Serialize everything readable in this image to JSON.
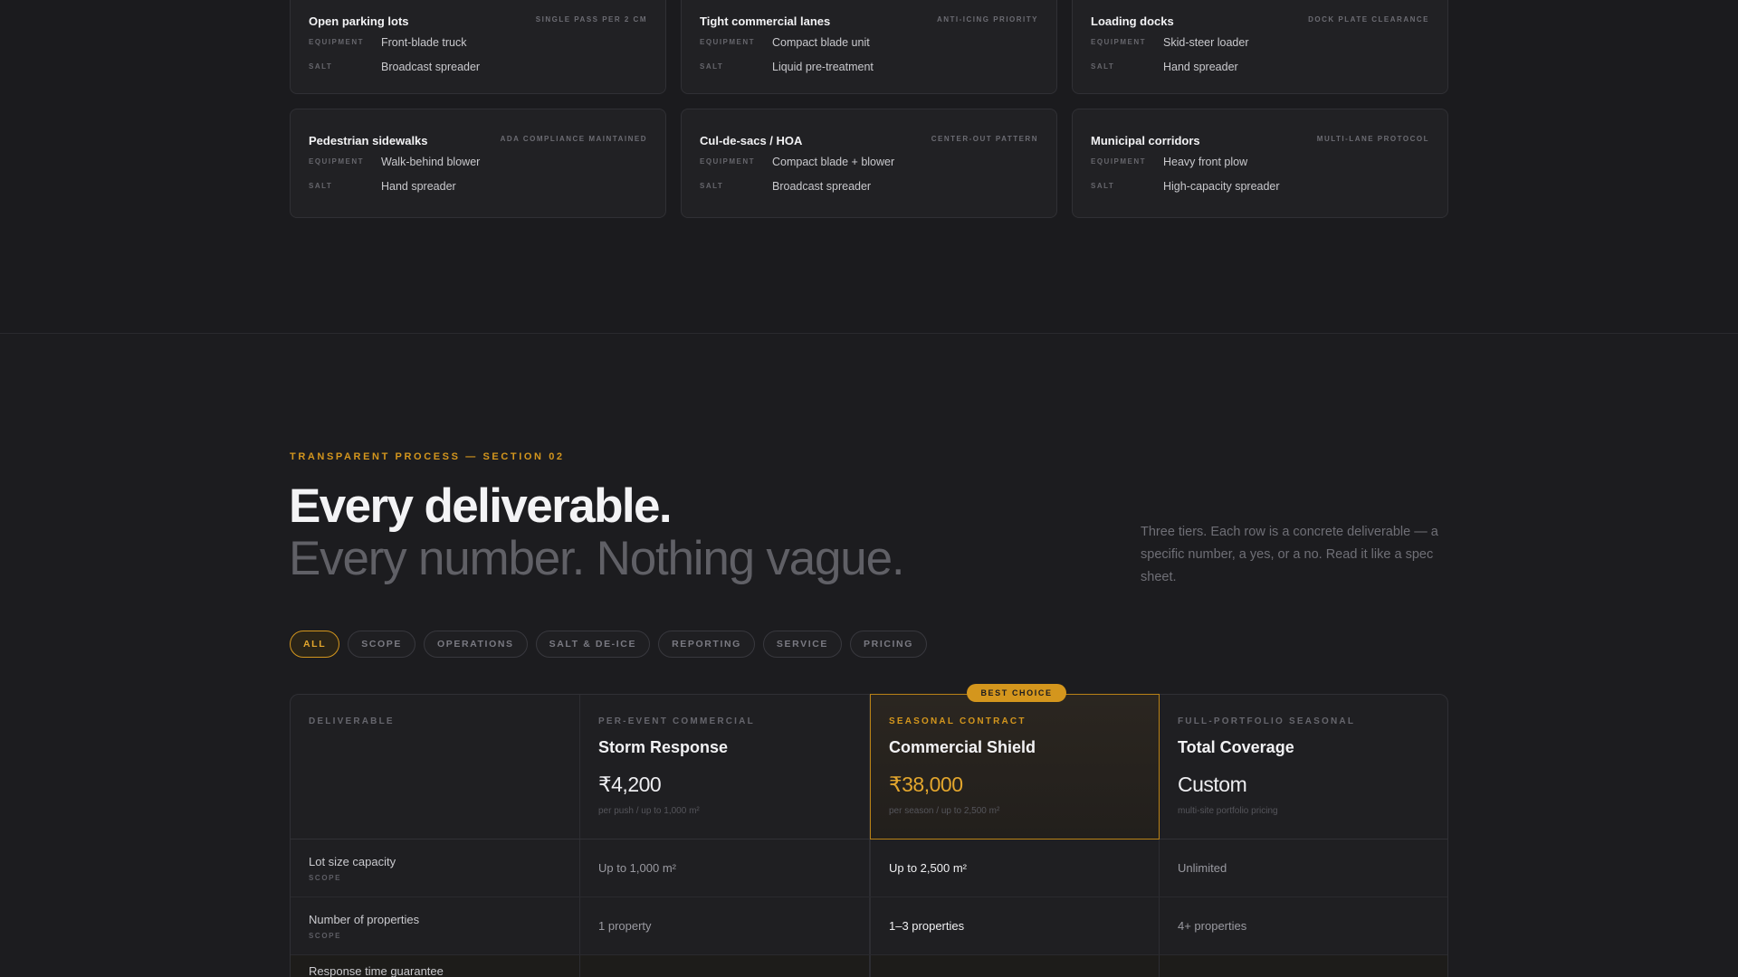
{
  "site_cards": [
    {
      "title": "Open parking lots",
      "tag": "SINGLE PASS PER 2 CM",
      "equipment_key": "EQUIPMENT",
      "equipment": "Front-blade truck",
      "salt_key": "SALT",
      "salt": "Broadcast spreader"
    },
    {
      "title": "Tight commercial lanes",
      "tag": "ANTI-ICING PRIORITY",
      "equipment_key": "EQUIPMENT",
      "equipment": "Compact blade unit",
      "salt_key": "SALT",
      "salt": "Liquid pre-treatment"
    },
    {
      "title": "Loading docks",
      "tag": "DOCK PLATE CLEARANCE",
      "equipment_key": "EQUIPMENT",
      "equipment": "Skid-steer loader",
      "salt_key": "SALT",
      "salt": "Hand spreader"
    },
    {
      "title": "Pedestrian sidewalks",
      "tag": "ADA COMPLIANCE MAINTAINED",
      "equipment_key": "EQUIPMENT",
      "equipment": "Walk-behind blower",
      "salt_key": "SALT",
      "salt": "Hand spreader"
    },
    {
      "title": "Cul-de-sacs / HOA",
      "tag": "CENTER-OUT PATTERN",
      "equipment_key": "EQUIPMENT",
      "equipment": "Compact blade + blower",
      "salt_key": "SALT",
      "salt": "Broadcast spreader"
    },
    {
      "title": "Municipal corridors",
      "tag": "MULTI-LANE PROTOCOL",
      "equipment_key": "EQUIPMENT",
      "equipment": "Heavy front plow",
      "salt_key": "SALT",
      "salt": "High-capacity spreader"
    }
  ],
  "section": {
    "eyebrow": "TRANSPARENT PROCESS — SECTION 02",
    "heading": "Every deliverable.",
    "subheading": "Every number. Nothing vague.",
    "intro": "Three tiers. Each row is a concrete deliverable — a specific number, a yes, or a no. Read it like a spec sheet."
  },
  "filters": [
    "ALL",
    "SCOPE",
    "OPERATIONS",
    "SALT & DE-ICE",
    "REPORTING",
    "SERVICE",
    "PRICING"
  ],
  "table": {
    "col_label": "DELIVERABLE",
    "badge": "BEST CHOICE",
    "tiers": [
      {
        "eyebrow": "PER-EVENT COMMERCIAL",
        "name": "Storm Response",
        "price": "₹4,200",
        "note": "per push / up to 1,000 m²"
      },
      {
        "eyebrow": "SEASONAL CONTRACT",
        "name": "Commercial Shield",
        "price": "₹38,000",
        "note": "per season / up to 2,500 m²"
      },
      {
        "eyebrow": "FULL-PORTFOLIO SEASONAL",
        "name": "Total Coverage",
        "price": "Custom",
        "note": "multi-site portfolio pricing"
      }
    ],
    "rows": [
      {
        "label": "Lot size capacity",
        "category": "SCOPE",
        "values": [
          "Up to 1,000 m²",
          "Up to 2,500 m²",
          "Unlimited"
        ]
      },
      {
        "label": "Number of properties",
        "category": "SCOPE",
        "values": [
          "1 property",
          "1–3 properties",
          "4+ properties"
        ]
      },
      {
        "label": "Response time guarantee",
        "category": "",
        "values": [
          "",
          "",
          ""
        ]
      }
    ]
  },
  "colors": {
    "accent": "#d4961d",
    "background": "#1c1c1f"
  }
}
